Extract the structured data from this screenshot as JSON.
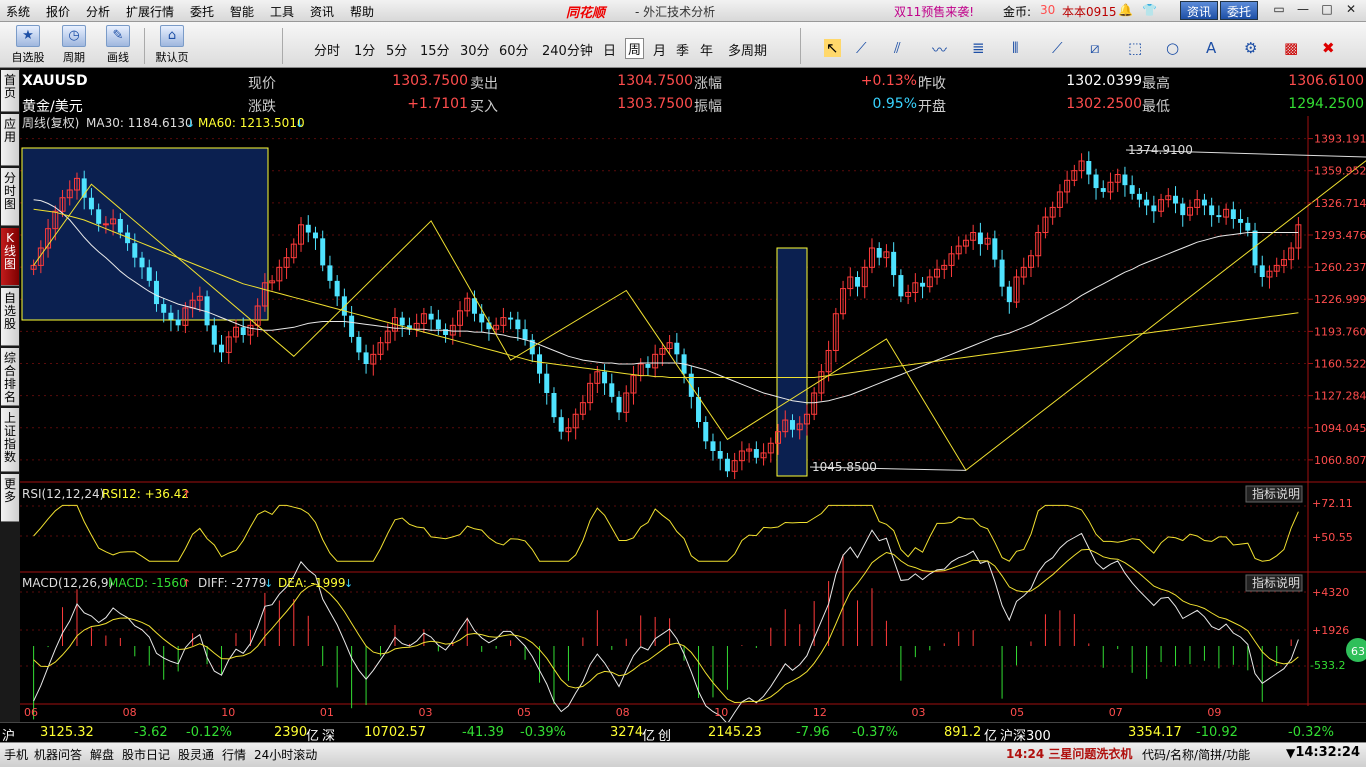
{
  "menu": [
    "系统",
    "报价",
    "分析",
    "扩展行情",
    "委托",
    "智能",
    "工具",
    "资讯",
    "帮助"
  ],
  "brand": "同花顺",
  "app_title": "- 外汇技术分析",
  "promo": "双11预售来袭!",
  "coin_label": "金币:",
  "coin_value": "30",
  "version": "本本0915",
  "btn_news": "资讯",
  "btn_trade": "委托",
  "toolbar": {
    "favorites": "自选股",
    "period": "周期",
    "draw": "画线",
    "default_page": "默认页",
    "periods": [
      "分时",
      "1分",
      "5分",
      "15分",
      "30分",
      "60分",
      "240分钟",
      "日",
      "周",
      "月",
      "季",
      "年",
      "多周期"
    ],
    "active_period": "周"
  },
  "sidebar": [
    "首页",
    "应用",
    "分时图",
    "K线图",
    "自选股",
    "综合排名",
    "上证指数",
    "更多"
  ],
  "sidebar_active": "K线图",
  "quote": {
    "symbol": "XAUUSD",
    "name": "黄金/美元",
    "labels": {
      "price": "现价",
      "change": "涨跌",
      "sell": "卖出",
      "buy": "买入",
      "pct": "涨幅",
      "amp": "振幅",
      "prev": "昨收",
      "open": "开盘",
      "high": "最高",
      "low": "最低"
    },
    "price": "1303.7500",
    "change": "+1.7101",
    "sell": "1304.7500",
    "buy": "1303.7500",
    "pct": "+0.13%",
    "amp": "0.95%",
    "prev": "1302.0399",
    "open": "1302.2500",
    "high": "1306.6100",
    "low": "1294.2500"
  },
  "indicators": {
    "main_label": "周线(复权)",
    "ma30": "MA30: 1184.6130",
    "ma60": "MA60: 1213.5010",
    "rsi_label": "RSI(12,12,24)",
    "rsi12": "RSI12: +36.42",
    "macd_label": "MACD(12,26,9)",
    "macd": "MACD: -1560",
    "diff": "DIFF: -2779",
    "dea": "DEA: -1999",
    "explain": "指标说明"
  },
  "chart_data": {
    "type": "candlestick",
    "price_ticks": [
      "1393.191",
      "1359.952",
      "1326.714",
      "1293.476",
      "1260.237",
      "1226.999",
      "1193.760",
      "1160.522",
      "1127.284",
      "1094.045",
      "1060.807"
    ],
    "price_range": [
      1040,
      1400
    ],
    "x_labels": [
      "06",
      "08",
      "10",
      "01",
      "03",
      "05",
      "08",
      "10",
      "12",
      "03",
      "05",
      "07",
      "09"
    ],
    "annotations": {
      "high": "1374.9100",
      "low": "1045.8500"
    },
    "closes": [
      1262,
      1280,
      1300,
      1318,
      1332,
      1340,
      1352,
      1332,
      1320,
      1305,
      1305,
      1310,
      1296,
      1285,
      1270,
      1260,
      1246,
      1222,
      1213,
      1206,
      1200,
      1218,
      1226,
      1230,
      1200,
      1180,
      1172,
      1188,
      1198,
      1190,
      1200,
      1220,
      1244,
      1246,
      1260,
      1270,
      1284,
      1304,
      1296,
      1290,
      1262,
      1246,
      1230,
      1210,
      1188,
      1172,
      1160,
      1170,
      1182,
      1194,
      1208,
      1200,
      1196,
      1202,
      1212,
      1206,
      1196,
      1190,
      1200,
      1215,
      1228,
      1212,
      1203,
      1196,
      1200,
      1208,
      1206,
      1196,
      1185,
      1170,
      1150,
      1130,
      1105,
      1090,
      1094,
      1108,
      1120,
      1140,
      1152,
      1140,
      1126,
      1110,
      1130,
      1148,
      1160,
      1156,
      1170,
      1176,
      1182,
      1170,
      1150,
      1126,
      1100,
      1080,
      1070,
      1062,
      1049,
      1060,
      1070,
      1072,
      1063,
      1068,
      1078,
      1090,
      1102,
      1092,
      1098,
      1108,
      1130,
      1152,
      1174,
      1212,
      1238,
      1250,
      1240,
      1260,
      1280,
      1270,
      1276,
      1252,
      1230,
      1234,
      1244,
      1240,
      1250,
      1258,
      1262,
      1274,
      1282,
      1288,
      1296,
      1284,
      1290,
      1268,
      1240,
      1224,
      1250,
      1260,
      1272,
      1296,
      1312,
      1322,
      1338,
      1350,
      1360,
      1370,
      1356,
      1342,
      1338,
      1348,
      1356,
      1345,
      1336,
      1330,
      1324,
      1318,
      1330,
      1334,
      1326,
      1314,
      1322,
      1330,
      1324,
      1314,
      1312,
      1320,
      1310,
      1306,
      1298,
      1262,
      1250,
      1256,
      1262,
      1268,
      1280,
      1304
    ],
    "ma30": [
      1330,
      1329,
      1326,
      1322,
      1316,
      1309,
      1300,
      1291,
      1283,
      1276,
      1270,
      1263,
      1256,
      1250,
      1245,
      1240,
      1235,
      1231,
      1228,
      1225,
      1222,
      1220,
      1218,
      1216,
      1214,
      1211,
      1208,
      1205,
      1202,
      1199,
      1197,
      1196,
      1195,
      1195,
      1196,
      1197,
      1198,
      1200,
      1202,
      1203,
      1204,
      1204,
      1204,
      1204,
      1203,
      1202,
      1201,
      1200,
      1199,
      1198,
      1197,
      1197,
      1196,
      1196,
      1196,
      1195,
      1195,
      1195,
      1194,
      1194,
      1194,
      1193,
      1193,
      1192,
      1191,
      1190,
      1188,
      1187,
      1185,
      1183,
      1180,
      1177,
      1174,
      1171,
      1168,
      1166,
      1164,
      1163,
      1162,
      1161,
      1161,
      1160,
      1160,
      1160,
      1161,
      1161,
      1161,
      1161,
      1161,
      1161,
      1160,
      1158,
      1156,
      1154,
      1151,
      1148,
      1145,
      1142,
      1139,
      1136,
      1133,
      1130,
      1128,
      1126,
      1124,
      1122,
      1121,
      1120,
      1120,
      1121,
      1122,
      1124,
      1126,
      1128,
      1131,
      1134,
      1137,
      1140,
      1143,
      1146,
      1149,
      1152,
      1155,
      1158,
      1161,
      1164,
      1167,
      1170,
      1173,
      1176,
      1179,
      1182,
      1185,
      1188,
      1190,
      1192,
      1195,
      1198,
      1201,
      1205,
      1209,
      1213,
      1217,
      1221,
      1226,
      1231,
      1235,
      1239,
      1243,
      1247,
      1251,
      1255,
      1258,
      1262,
      1265,
      1268,
      1271,
      1274,
      1277,
      1280,
      1283,
      1286,
      1288,
      1290,
      1292,
      1293,
      1294,
      1295,
      1296,
      1296,
      1296,
      1296,
      1296,
      1296,
      1296,
      1296
    ],
    "ma60": [
      1320,
      1319,
      1318,
      1317,
      1315,
      1313,
      1311,
      1309,
      1306,
      1303,
      1300,
      1297,
      1294,
      1291,
      1288,
      1285,
      1282,
      1279,
      1276,
      1273,
      1270,
      1267,
      1264,
      1261,
      1258,
      1255,
      1252,
      1249,
      1246,
      1243,
      1241,
      1239,
      1237,
      1235,
      1233,
      1231,
      1229,
      1227,
      1225,
      1223,
      1221,
      1219,
      1217,
      1215,
      1213,
      1211,
      1209,
      1207,
      1205,
      1203,
      1201,
      1199,
      1197,
      1195,
      1193,
      1191,
      1189,
      1187,
      1185,
      1183,
      1181,
      1179,
      1177,
      1175,
      1173,
      1171,
      1169,
      1167,
      1165,
      1163,
      1162,
      1161,
      1160,
      1159,
      1158,
      1157,
      1156,
      1155,
      1154,
      1153,
      1152,
      1151,
      1150,
      1149,
      1148,
      1148,
      1147,
      1147,
      1146,
      1146,
      1146,
      1146,
      1146,
      1146,
      1146,
      1146,
      1146,
      1146,
      1146,
      1146,
      1146,
      1146,
      1146,
      1146,
      1146,
      1146,
      1146,
      1146,
      1146,
      1147,
      1148,
      1149,
      1150,
      1151,
      1152,
      1153,
      1154,
      1155,
      1156,
      1157,
      1158,
      1159,
      1160,
      1161,
      1162,
      1163,
      1164,
      1165,
      1166,
      1167,
      1168,
      1169,
      1170,
      1171,
      1172,
      1173,
      1174,
      1175,
      1176,
      1177,
      1178,
      1179,
      1180,
      1181,
      1182,
      1183,
      1184,
      1185,
      1186,
      1187,
      1188,
      1189,
      1190,
      1191,
      1192,
      1193,
      1194,
      1195,
      1196,
      1197,
      1198,
      1199,
      1200,
      1201,
      1202,
      1203,
      1204,
      1205,
      1206,
      1207,
      1208,
      1209,
      1210,
      1211,
      1212,
      1213
    ]
  },
  "status": {
    "sh_label": "沪",
    "sh_index": "3125.32",
    "sh_change": "-3.62",
    "sh_pct": "-0.12%",
    "sh_amount": "2390",
    "unit": "亿",
    "sz_label": "深",
    "sz_index": "10702.57",
    "sz_change": "-41.39",
    "sz_pct": "-0.39%",
    "sz_amount": "3274",
    "cy_label": "创",
    "cy_index": "2145.23",
    "cy_change": "-7.96",
    "cy_pct": "-0.37%",
    "hs_amount": "891.2",
    "hs_label": "沪深300",
    "hs_index": "3354.17",
    "hs_change": "-10.92",
    "hs_pct": "-0.32%"
  },
  "bottom_tabs": [
    "手机",
    "机器问答",
    "解盘",
    "股市日记",
    "股灵通",
    "行情",
    "24小时滚动"
  ],
  "ticker": "14:24 三星问题洗衣机",
  "search_hint": "代码/名称/简拼/功能",
  "clock": "14:32:24",
  "badge": "63"
}
